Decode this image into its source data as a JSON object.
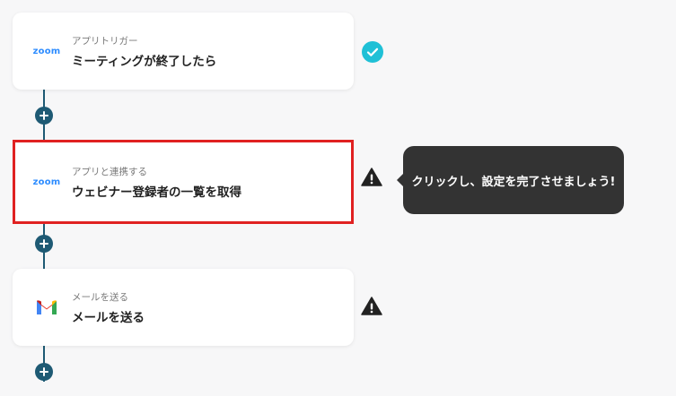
{
  "steps": [
    {
      "app": "zoom",
      "subtitle": "アプリトリガー",
      "title": "ミーティングが終了したら",
      "status": "complete"
    },
    {
      "app": "zoom",
      "subtitle": "アプリと連携する",
      "title": "ウェビナー登録者の一覧を取得",
      "status": "warning"
    },
    {
      "app": "gmail",
      "subtitle": "メールを送る",
      "title": "メールを送る",
      "status": "warning"
    }
  ],
  "app_logos": {
    "zoom": "zoom"
  },
  "tooltip": {
    "text": "クリックし、設定を完了させましょう!"
  },
  "colors": {
    "connector": "#1e5a74",
    "check": "#1fc0d6",
    "warning": "#222222",
    "highlight": "#e02121",
    "tooltip_bg": "#333333"
  }
}
